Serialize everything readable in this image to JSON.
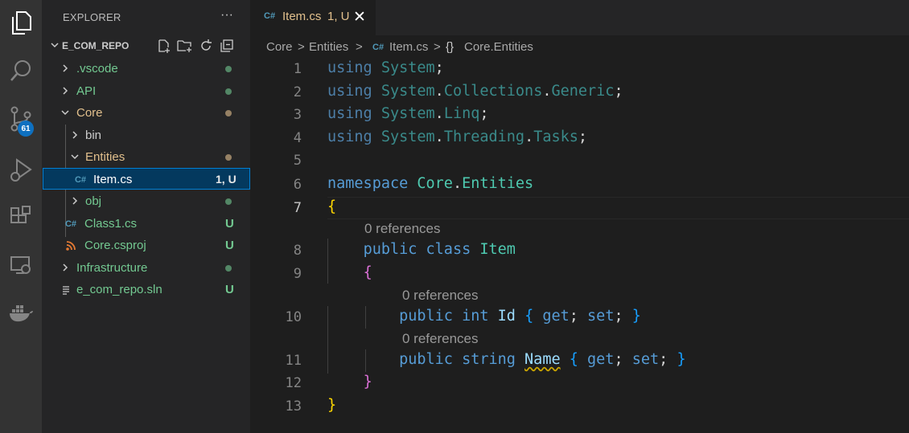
{
  "activity_bar": {
    "icons": [
      "explorer-icon",
      "search-icon",
      "source-control-icon",
      "run-debug-icon",
      "extensions-icon",
      "remote-explorer-icon",
      "docker-icon"
    ],
    "source_control_badge": "61"
  },
  "explorer": {
    "title": "EXPLORER",
    "more": "···",
    "repo_name": "E_COM_REPO",
    "items": [
      {
        "label": ".vscode",
        "marker": ""
      },
      {
        "label": "API",
        "marker": ""
      },
      {
        "label": "Core",
        "marker": ""
      },
      {
        "label": "bin",
        "marker": ""
      },
      {
        "label": "Entities",
        "marker": ""
      },
      {
        "label": "Item.cs",
        "marker": "1, U"
      },
      {
        "label": "obj",
        "marker": ""
      },
      {
        "label": "Class1.cs",
        "marker": "U"
      },
      {
        "label": "Core.csproj",
        "marker": "U"
      },
      {
        "label": "Infrastructure",
        "marker": ""
      },
      {
        "label": "e_com_repo.sln",
        "marker": "U"
      }
    ]
  },
  "tab": {
    "icon": "C#",
    "name": "Item.cs",
    "status": "1, U",
    "close": "✕"
  },
  "breadcrumb": {
    "parts": [
      "Core",
      "Entities",
      "Item.cs",
      "Core.Entities"
    ],
    "sep": ">",
    "ns_icon": "{}"
  },
  "editor": {
    "line_numbers": [
      "1",
      "2",
      "3",
      "4",
      "5",
      "6",
      "7",
      "8",
      "9",
      "10",
      "11",
      "12",
      "13"
    ],
    "lens": "0 references",
    "lines": {
      "l1": {
        "kw": "using",
        "a": "System",
        ";": ";"
      },
      "l2": {
        "kw": "using",
        "a": "System",
        "b": "Collections",
        "c": "Generic"
      },
      "l3": {
        "kw": "using",
        "a": "System",
        "b": "Linq"
      },
      "l4": {
        "kw": "using",
        "a": "System",
        "b": "Threading",
        "c": "Tasks"
      },
      "l6": {
        "kw": "namespace",
        "a": "Core",
        "b": "Entities"
      },
      "l8": {
        "kw1": "public",
        "kw2": "class",
        "name": "Item"
      },
      "l10": {
        "kw1": "public",
        "kw2": "int",
        "name": "Id",
        "get": "get",
        "set": "set"
      },
      "l11": {
        "kw1": "public",
        "kw2": "string",
        "name": "Name",
        "get": "get",
        "set": "set"
      }
    },
    "dot": ".",
    "semi": ";",
    "open": "{",
    "close": "}"
  },
  "colors": {
    "untracked": "#73c991",
    "modified": "#e2c08d",
    "keyword": "#569cd6",
    "type": "#4ec9b0"
  }
}
